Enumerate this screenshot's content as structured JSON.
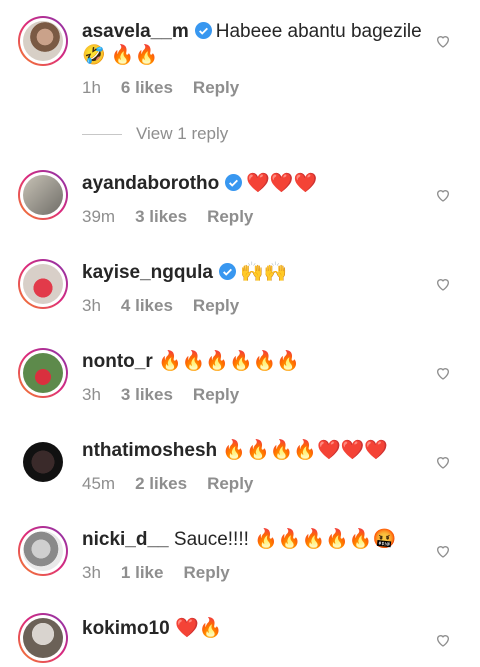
{
  "view_replies_label": "View 1 reply",
  "comments": [
    {
      "username": "asavela__m",
      "verified": true,
      "text": "Habeee abantu bagezile 🤣 🔥🔥",
      "time": "1h",
      "likes": "6 likes",
      "reply": "Reply"
    },
    {
      "username": "ayandaborotho",
      "verified": true,
      "text": "❤️❤️❤️",
      "time": "39m",
      "likes": "3 likes",
      "reply": "Reply"
    },
    {
      "username": "kayise_ngqula",
      "verified": true,
      "text": "🙌🙌",
      "time": "3h",
      "likes": "4 likes",
      "reply": "Reply"
    },
    {
      "username": "nonto_r",
      "verified": false,
      "text": "🔥🔥🔥🔥🔥🔥",
      "time": "3h",
      "likes": "3 likes",
      "reply": "Reply"
    },
    {
      "username": "nthatimoshesh",
      "verified": false,
      "text": "🔥🔥🔥🔥❤️❤️❤️",
      "time": "45m",
      "likes": "2 likes",
      "reply": "Reply"
    },
    {
      "username": "nicki_d__",
      "verified": false,
      "text": "Sauce!!!! 🔥🔥🔥🔥🔥🤬",
      "time": "3h",
      "likes": "1 like",
      "reply": "Reply"
    },
    {
      "username": "kokimo10",
      "verified": false,
      "text": "❤️🔥",
      "time": "",
      "likes": "",
      "reply": ""
    }
  ],
  "colors": {
    "text": "#262626",
    "muted": "#8e8e8e",
    "verified": "#3897f0"
  }
}
